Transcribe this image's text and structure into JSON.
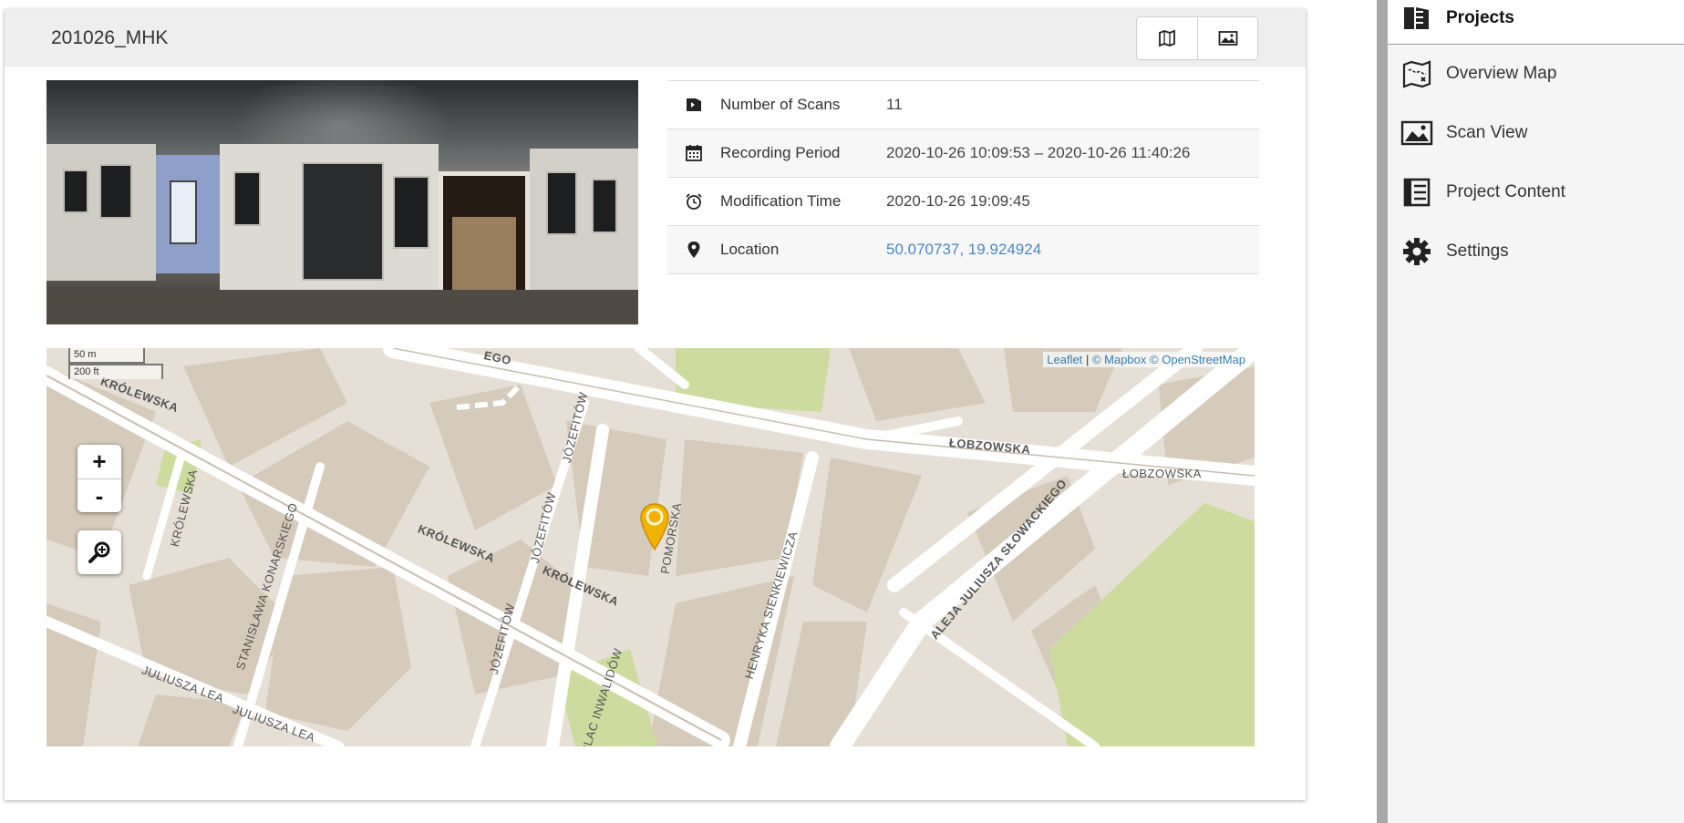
{
  "project": {
    "title": "201026_MHK",
    "header_buttons": [
      {
        "icon": "map-icon"
      },
      {
        "icon": "image-icon"
      }
    ]
  },
  "info": {
    "rows": [
      {
        "icon": "scans-icon",
        "label": "Number of Scans",
        "value": "11"
      },
      {
        "icon": "calendar-icon",
        "label": "Recording Period",
        "value": "2020-10-26 10:09:53 – 2020-10-26 11:40:26"
      },
      {
        "icon": "alarm-clock-icon",
        "label": "Modification Time",
        "value": "2020-10-26 19:09:45"
      },
      {
        "icon": "location-pin-icon",
        "label": "Location",
        "value": "50.070737, 19.924924"
      }
    ]
  },
  "map": {
    "attribution": {
      "leaflet": "Leaflet",
      "separator": "|",
      "mapbox": "© Mapbox",
      "osm": "© OpenStreetMap"
    },
    "scale": {
      "metric": "50 m",
      "imperial": "200 ft"
    },
    "zoom_in": "+",
    "zoom_out": "-",
    "street_labels": {
      "s1": "KRÓLEWSKA",
      "s2": "ŁOBZOWSKA",
      "s3": "ŁOBZOWSKA",
      "s4": "KRÓLEWSKA",
      "s5": "KRÓLEWSKA",
      "s6": "KRÓLEWSKA",
      "s7": "JÓZEFITÓW",
      "s8": "JÓZEFITÓW",
      "s9": "JÓZEFITÓW",
      "s10": "POMORSKA",
      "s11": "HENRYKA SIENKIEWICZA",
      "s12": "ALEJA JULIUSZA SŁOWACKIEGO",
      "s13": "STANISŁAWA KONARSKIEGO",
      "s14": "JULIUSZA LEA",
      "s15": "JULIUSZA LEA",
      "s16": "PLAC INWALIDÓW",
      "s17": "EGO"
    },
    "colors": {
      "land": "#e6dfd5",
      "building": "#d5c9ba",
      "road": "#ffffff",
      "park": "#cddc9f",
      "marker": "#f0b400"
    }
  },
  "sidebar": {
    "items": [
      {
        "icon": "projects-icon",
        "label": "Projects",
        "active": true
      },
      {
        "icon": "overview-map-icon",
        "label": "Overview Map"
      },
      {
        "icon": "scan-view-icon",
        "label": "Scan View"
      },
      {
        "icon": "project-content-icon",
        "label": "Project Content"
      },
      {
        "icon": "settings-icon",
        "label": "Settings"
      }
    ]
  }
}
